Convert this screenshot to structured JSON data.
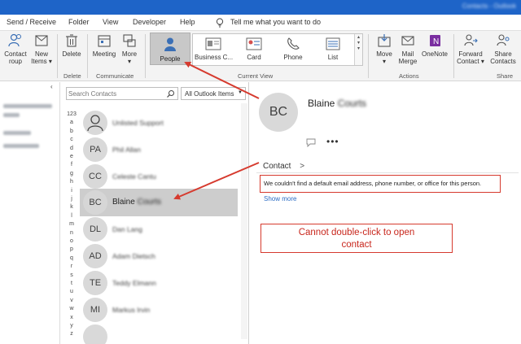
{
  "menu": {
    "tabs": [
      "Send / Receive",
      "Folder",
      "View",
      "Developer",
      "Help"
    ],
    "tell_me": "Tell me what you want to do"
  },
  "ribbon": {
    "buttons": {
      "contact": "Contact",
      "group_fragment": "roup",
      "new_items": "New",
      "new_items_2": "Items",
      "delete": "Delete",
      "meeting": "Meeting",
      "more": "More",
      "people": "People",
      "business_card": "Business C...",
      "card": "Card",
      "phone": "Phone",
      "list": "List",
      "move": "Move",
      "mail_merge": "Mail",
      "mail_merge_2": "Merge",
      "onenote": "OneNote",
      "forward_contact": "Forward",
      "forward_contact_2": "Contact",
      "share_contacts": "Share",
      "share_contacts_2": "Contacts"
    },
    "groups": {
      "delete": "Delete",
      "communicate": "Communicate",
      "current_view": "Current View",
      "actions": "Actions",
      "share": "Share"
    }
  },
  "list": {
    "search_placeholder": "Search Contacts",
    "scope": "All Outlook Items",
    "letters": [
      "123",
      "a",
      "b",
      "c",
      "d",
      "e",
      "f",
      "g",
      "h",
      "i",
      "j",
      "k",
      "l",
      "m",
      "n",
      "o",
      "p",
      "q",
      "r",
      "s",
      "t",
      "u",
      "v",
      "w",
      "x",
      "y",
      "z"
    ],
    "contacts": [
      {
        "initials": "",
        "name": "Unlisted Support"
      },
      {
        "initials": "PA",
        "name": "Phil Allan"
      },
      {
        "initials": "CC",
        "name": "Celeste Cantu"
      },
      {
        "initials": "BC",
        "name": "Blaine",
        "name_blurred": "Courts"
      },
      {
        "initials": "DL",
        "name": "Dan Lang"
      },
      {
        "initials": "AD",
        "name": "Adam Dietsch"
      },
      {
        "initials": "TE",
        "name": "Teddy Elmann"
      },
      {
        "initials": "MI",
        "name": "Markus Irvin"
      },
      {
        "initials": "",
        "name": ""
      }
    ]
  },
  "reading": {
    "initials": "BC",
    "first_name": "Blaine",
    "last_name_blurred": "Courts",
    "contact_tab": "Contact",
    "message": "We couldn't find a default email address, phone number, or office for this person.",
    "show_more": "Show more"
  },
  "annotation": {
    "line1": "Cannot double-click to open",
    "line2": "contact"
  },
  "colors": {
    "title_bar": "#1e64c8",
    "annotation_red": "#d63a2e",
    "selection": "#cdcdcd",
    "link_blue": "#2b6cc4"
  }
}
